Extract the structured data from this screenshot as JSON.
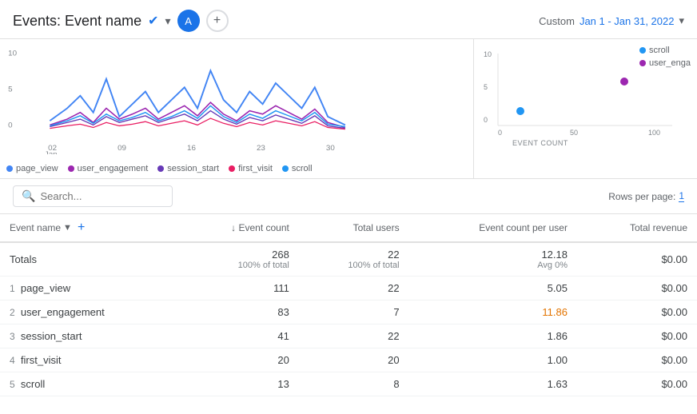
{
  "header": {
    "title": "Events: Event name",
    "avatar_label": "A",
    "date_label": "Custom",
    "date_range": "Jan 1 - Jan 31, 2022"
  },
  "search": {
    "placeholder": "Search...",
    "value": ""
  },
  "rows_per_page": {
    "label": "Rows per page:",
    "value": "1"
  },
  "legend": {
    "items": [
      {
        "label": "page_view",
        "color": "#4285f4"
      },
      {
        "label": "user_engagement",
        "color": "#9c27b0"
      },
      {
        "label": "session_start",
        "color": "#673ab7"
      },
      {
        "label": "first_visit",
        "color": "#e91e63"
      },
      {
        "label": "scroll",
        "color": "#2196f3"
      }
    ]
  },
  "scatter_legend": {
    "items": [
      {
        "label": "scroll",
        "color": "#2196f3"
      },
      {
        "label": "user_enga",
        "color": "#9c27b0"
      }
    ]
  },
  "scatter_axes": {
    "y_max": "10",
    "y_mid": "5",
    "y_zero": "0",
    "x_zero": "0",
    "x_mid": "50",
    "x_max": "100",
    "x_label": "EVENT COUNT"
  },
  "table": {
    "columns": [
      {
        "label": "Event name",
        "key": "name",
        "sortable": true,
        "sort_arrow": "▼",
        "numeric": false
      },
      {
        "label": "↓ Event count",
        "key": "event_count",
        "numeric": true
      },
      {
        "label": "Total users",
        "key": "total_users",
        "numeric": true
      },
      {
        "label": "Event count per user",
        "key": "per_user",
        "numeric": true
      },
      {
        "label": "Total revenue",
        "key": "revenue",
        "numeric": true
      }
    ],
    "totals": {
      "label": "Totals",
      "event_count": "268",
      "event_count_sub": "100% of total",
      "total_users": "22",
      "total_users_sub": "100% of total",
      "per_user": "12.18",
      "per_user_sub": "Avg 0%",
      "revenue": "$0.00"
    },
    "rows": [
      {
        "num": "1",
        "name": "page_view",
        "event_count": "111",
        "total_users": "22",
        "per_user": "5.05",
        "per_user_color": "normal",
        "revenue": "$0.00"
      },
      {
        "num": "2",
        "name": "user_engagement",
        "event_count": "83",
        "total_users": "7",
        "per_user": "11.86",
        "per_user_color": "orange",
        "revenue": "$0.00"
      },
      {
        "num": "3",
        "name": "session_start",
        "event_count": "41",
        "total_users": "22",
        "per_user": "1.86",
        "per_user_color": "normal",
        "revenue": "$0.00"
      },
      {
        "num": "4",
        "name": "first_visit",
        "event_count": "20",
        "total_users": "20",
        "per_user": "1.00",
        "per_user_color": "normal",
        "revenue": "$0.00"
      },
      {
        "num": "5",
        "name": "scroll",
        "event_count": "13",
        "total_users": "8",
        "per_user": "1.63",
        "per_user_color": "normal",
        "revenue": "$0.00"
      }
    ]
  }
}
